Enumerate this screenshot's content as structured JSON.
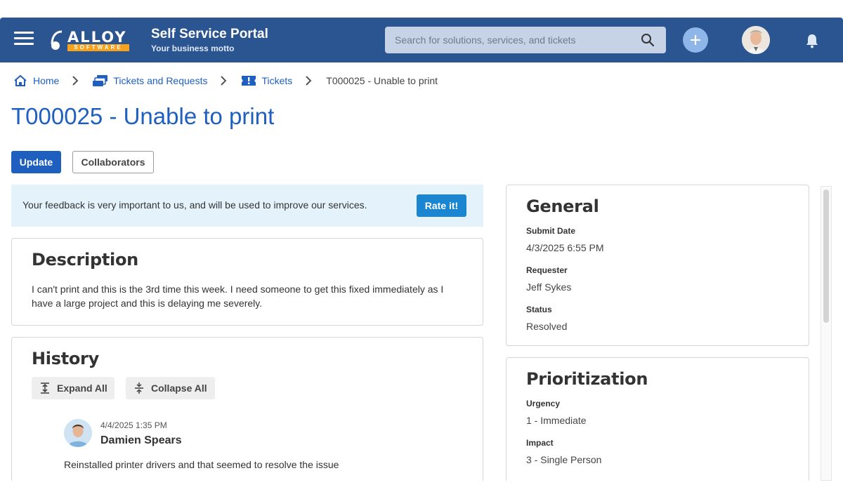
{
  "header": {
    "title": "Self Service Portal",
    "motto": "Your business motto",
    "logo_text": "ALLOY",
    "logo_sub": "SOFTWARE",
    "search_placeholder": "Search for solutions, services, and tickets",
    "colors": {
      "bar": "#2b5591",
      "accent": "#f6a21d"
    }
  },
  "breadcrumb": {
    "items": [
      {
        "label": "Home",
        "icon": "home-icon"
      },
      {
        "label": "Tickets and Requests",
        "icon": "tickets-requests-icon"
      },
      {
        "label": "Tickets",
        "icon": "ticket-icon"
      }
    ],
    "current": "T000025 - Unable to print"
  },
  "page": {
    "title": "T000025 - Unable to print",
    "update_label": "Update",
    "collaborators_label": "Collaborators"
  },
  "feedback": {
    "text": "Your feedback is very important to us, and will be used to improve our services.",
    "button": "Rate it!"
  },
  "description": {
    "heading": "Description",
    "text": "I can't print and this is the 3rd time this week. I need someone to get this fixed immediately as I have a large project and this is delaying me severely."
  },
  "history": {
    "heading": "History",
    "expand_label": "Expand All",
    "collapse_label": "Collapse All",
    "entries": [
      {
        "date": "4/4/2025 1:35 PM",
        "author": "Damien Spears",
        "text": "Reinstalled printer drivers and that seemed to resolve the issue"
      }
    ]
  },
  "general": {
    "heading": "General",
    "fields": [
      {
        "label": "Submit Date",
        "value": "4/3/2025 6:55 PM"
      },
      {
        "label": "Requester",
        "value": "Jeff Sykes"
      },
      {
        "label": "Status",
        "value": "Resolved"
      }
    ]
  },
  "prioritization": {
    "heading": "Prioritization",
    "fields": [
      {
        "label": "Urgency",
        "value": "1 - Immediate"
      },
      {
        "label": "Impact",
        "value": "3 - Single Person"
      }
    ]
  }
}
